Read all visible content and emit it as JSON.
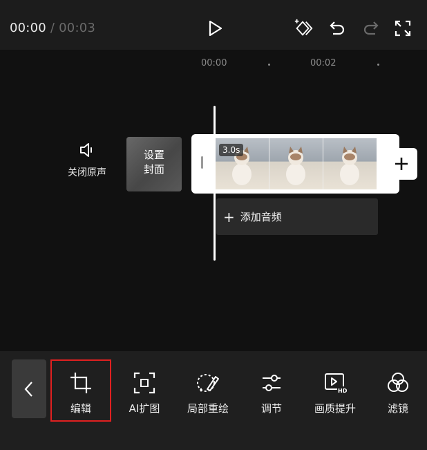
{
  "header": {
    "current_time": "00:00",
    "separator": "/",
    "total_time": "00:03"
  },
  "ruler": {
    "marks": [
      "00:00",
      "00:02"
    ]
  },
  "track": {
    "mute_label": "关闭原声",
    "cover_label_line1": "设置",
    "cover_label_line2": "封面",
    "clip_duration": "3.0s",
    "add_audio_label": "添加音频"
  },
  "toolbar": {
    "tools": [
      {
        "label": "编辑",
        "icon": "crop-icon",
        "selected": true
      },
      {
        "label": "AI扩图",
        "icon": "ai-expand-icon"
      },
      {
        "label": "局部重绘",
        "icon": "partial-redraw-icon"
      },
      {
        "label": "调节",
        "icon": "adjust-sliders-icon"
      },
      {
        "label": "画质提升",
        "icon": "hd-enhance-icon"
      },
      {
        "label": "滤镜",
        "icon": "filter-icon"
      }
    ]
  },
  "colors": {
    "background": "#111111",
    "toolbar_bg": "#1f1f1f",
    "highlight": "#e02020"
  }
}
